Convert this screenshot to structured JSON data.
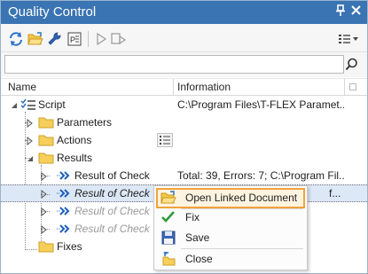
{
  "window": {
    "title": "Quality Control",
    "pin_glyph": "↑",
    "close_glyph": "✕"
  },
  "toolbar": {
    "buttons": [
      "refresh-icon",
      "open-folder-icon",
      "wrench-icon",
      "report-icon",
      "play-icon",
      "step-run-icon"
    ],
    "view_menu": "list-view-icon"
  },
  "search": {
    "value": "",
    "placeholder": ""
  },
  "columns": {
    "name": "Name",
    "information": "Information"
  },
  "tree": {
    "script": {
      "label": "Script",
      "info": "C:\\Program Files\\T-FLEX Paramet..."
    },
    "parameters": {
      "label": "Parameters"
    },
    "actions": {
      "label": "Actions"
    },
    "results": {
      "label": "Results"
    },
    "result1": {
      "label": "Result of Check",
      "info": "Total: 39, Errors: 7; C:\\Program Fil..."
    },
    "result2": {
      "label": "Result of Check",
      "info": "f..."
    },
    "result3": {
      "label": "Result of Check"
    },
    "result4": {
      "label": "Result of Check"
    },
    "fixes": {
      "label": "Fixes"
    }
  },
  "context_menu": {
    "items": [
      {
        "label": "Open Linked Document",
        "icon": "open-folder-icon"
      },
      {
        "label": "Fix",
        "icon": "checkmark-icon"
      },
      {
        "label": "Save",
        "icon": "floppy-disk-icon"
      },
      {
        "label": "Close",
        "icon": "close-document-icon"
      }
    ]
  },
  "colors": {
    "titlebar": "#3a74b3",
    "selection": "#dde8f6",
    "menu_highlight_border": "#f0a23a",
    "arrow_blue": "#1c5fc0",
    "folder_yellow": "#f5cf5a"
  }
}
